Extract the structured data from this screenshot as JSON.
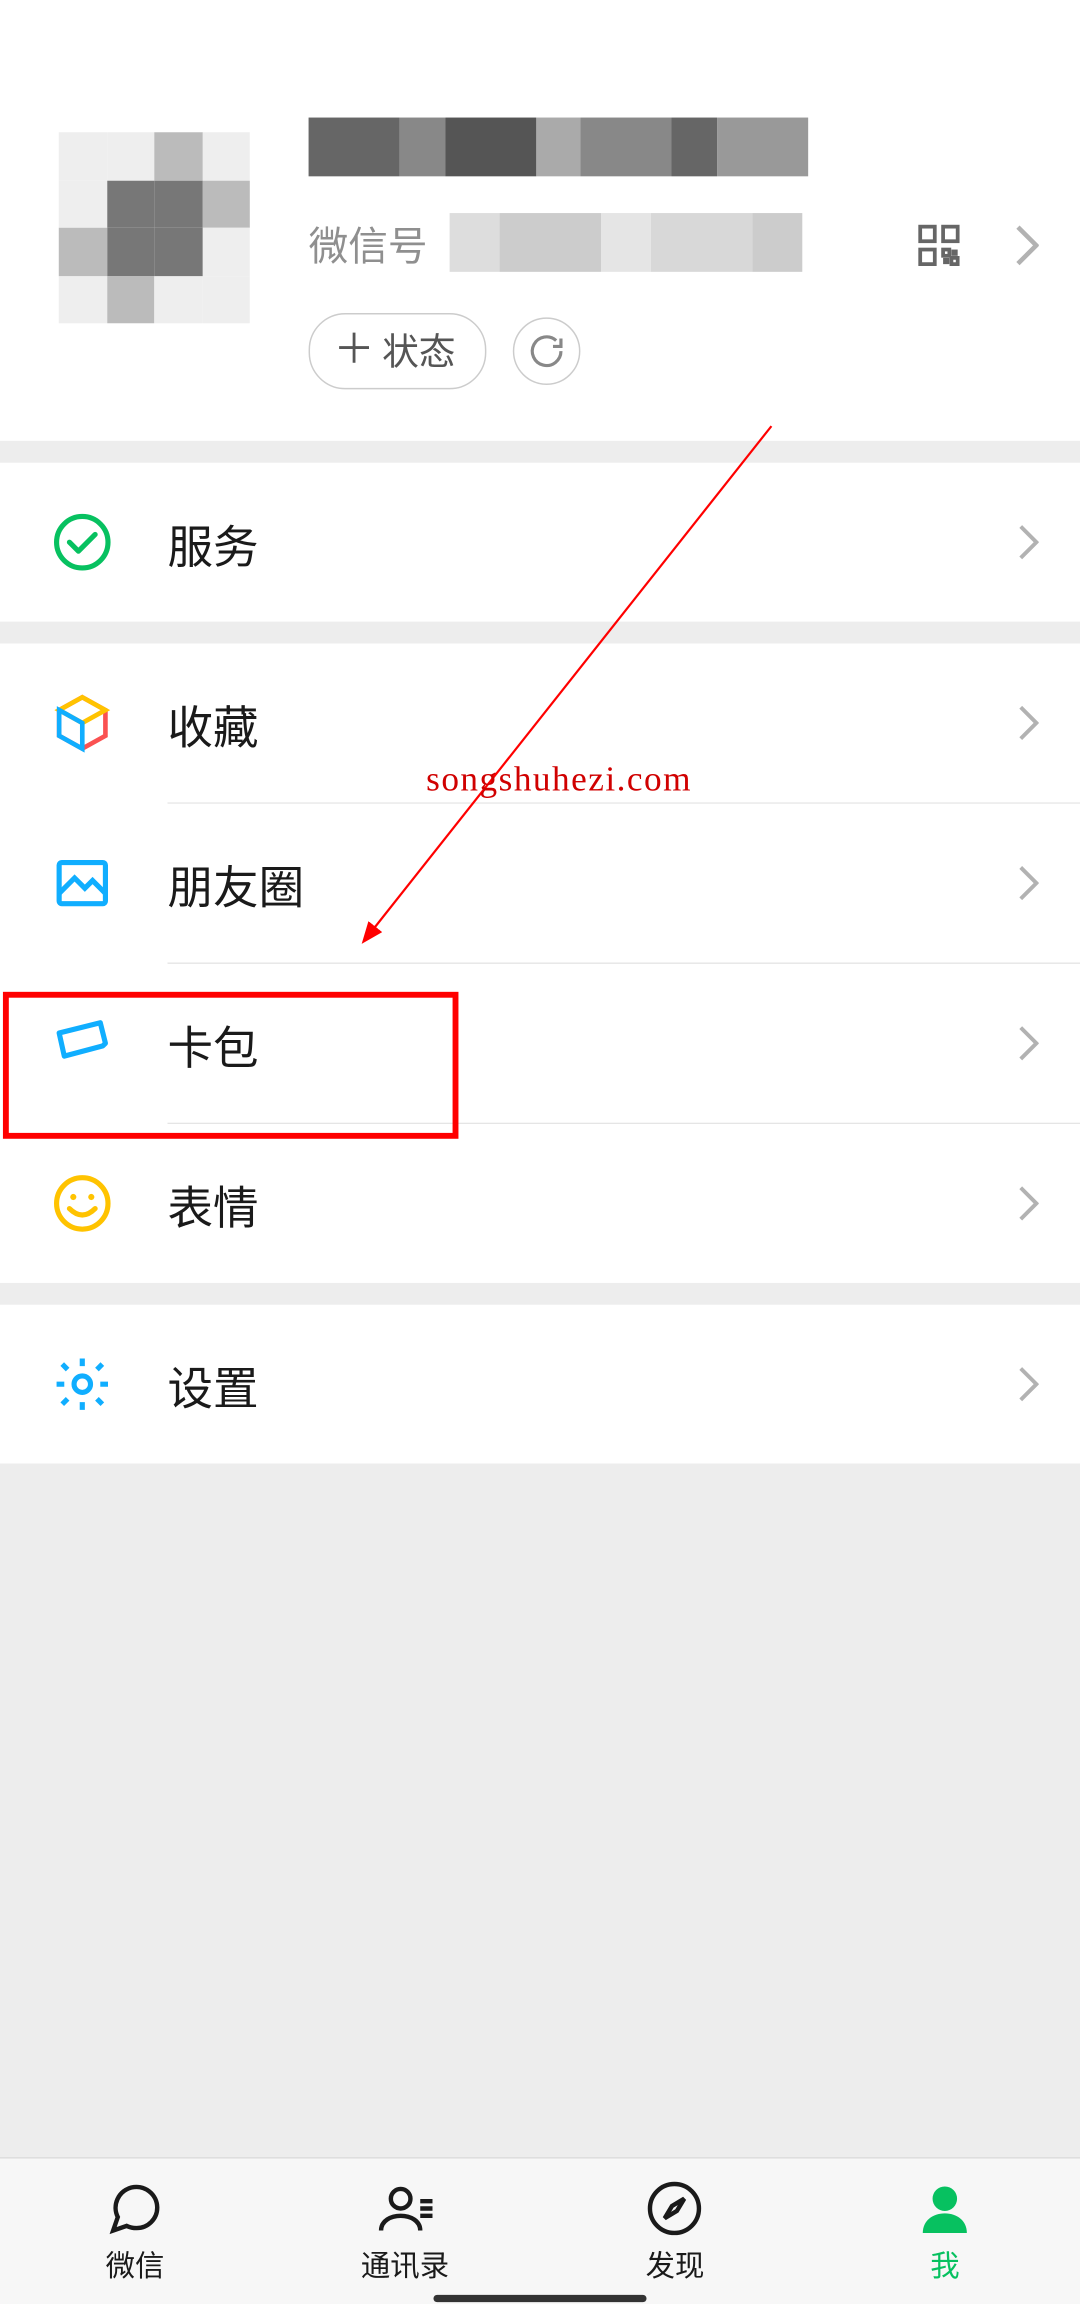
{
  "profile": {
    "wxid_label": "微信号",
    "status_button": "状态"
  },
  "menu": {
    "services": "服务",
    "favorites": "收藏",
    "moments": "朋友圈",
    "cards": "卡包",
    "stickers": "表情",
    "settings": "设置"
  },
  "tabs": {
    "chats": "微信",
    "contacts": "通讯录",
    "discover": "发现",
    "me": "我"
  },
  "annotation": {
    "watermark": "songshuhezi.com"
  }
}
